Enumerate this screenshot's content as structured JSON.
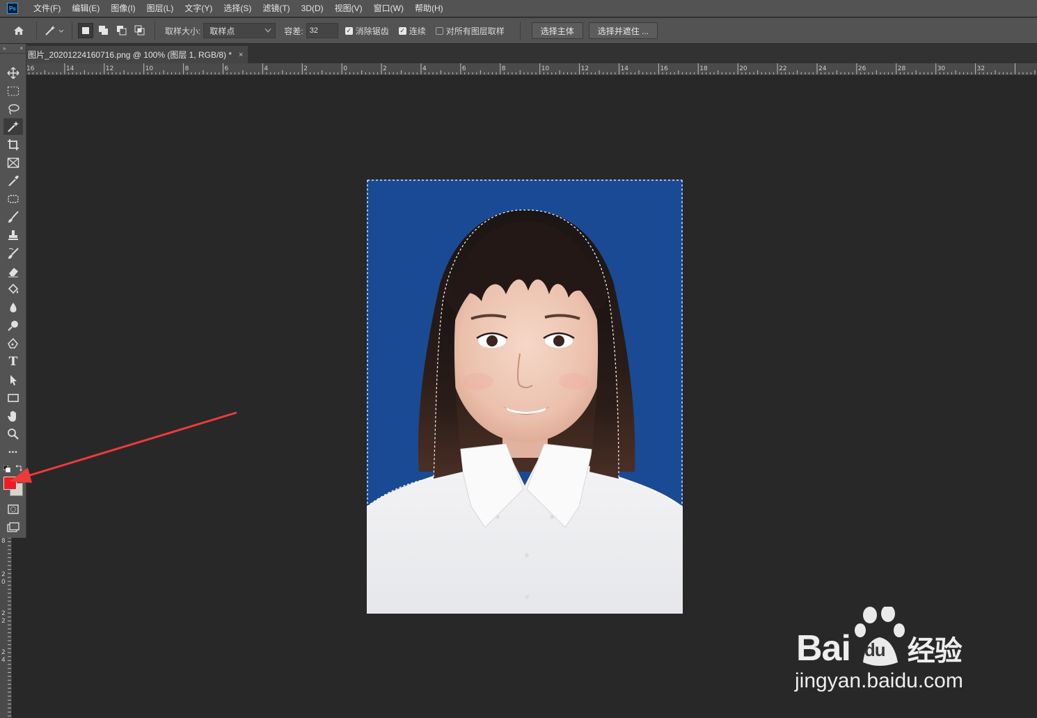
{
  "app": {
    "logo": "Ps"
  },
  "menu": [
    "文件(F)",
    "编辑(E)",
    "图像(I)",
    "图层(L)",
    "文字(Y)",
    "选择(S)",
    "滤镜(T)",
    "3D(D)",
    "视图(V)",
    "窗口(W)",
    "帮助(H)"
  ],
  "options": {
    "sample_size_label": "取样大小:",
    "sample_size_value": "取样点",
    "tolerance_label": "容差:",
    "tolerance_value": "32",
    "antialias_label": "消除锯齿",
    "antialias_checked": true,
    "contiguous_label": "连续",
    "contiguous_checked": true,
    "sample_all_layers_label": "对所有图层取样",
    "sample_all_layers_checked": false,
    "select_subject_label": "选择主体",
    "select_and_mask_label": "选择并遮住 ..."
  },
  "document_tab": {
    "title": "图片_20201224160716.png @ 100% (图层 1, RGB/8) *",
    "close": "×"
  },
  "ruler_h_labels": [
    "16",
    "14",
    "12",
    "10",
    "8",
    "6",
    "4",
    "2",
    "0",
    "2",
    "4",
    "6",
    "8",
    "10",
    "12",
    "14",
    "16",
    "18",
    "20",
    "22",
    "24",
    "26",
    "28",
    "30",
    "32"
  ],
  "ruler_v_labels": [
    "8",
    "2 0",
    "2 2",
    "2 4"
  ],
  "toolbox": {
    "header_left": "»",
    "header_right": "×",
    "tools": [
      "move-tool",
      "rectangular-marquee-tool",
      "lasso-tool",
      "magic-wand-tool",
      "crop-tool",
      "frame-tool",
      "eyedropper-tool",
      "spot-healing-tool",
      "brush-tool",
      "clone-stamp-tool",
      "history-brush-tool",
      "eraser-tool",
      "paint-bucket-tool",
      "blur-tool",
      "dodge-tool",
      "pen-tool",
      "type-tool",
      "path-selection-tool",
      "rectangle-tool",
      "hand-tool",
      "zoom-tool",
      "more-tools"
    ],
    "type_glyph": "T",
    "more_glyph": "•••",
    "foreground_color": "#ee1c24",
    "background_color": "#d8d4cc"
  },
  "colors": {
    "photo_background": "#1a4a93",
    "annotation_arrow": "#f03a3a",
    "canvas": "#282828"
  },
  "watermark": {
    "brand": "Bai",
    "brand_du": "du",
    "brand_cn": "经验",
    "url": "jingyan.baidu.com"
  }
}
